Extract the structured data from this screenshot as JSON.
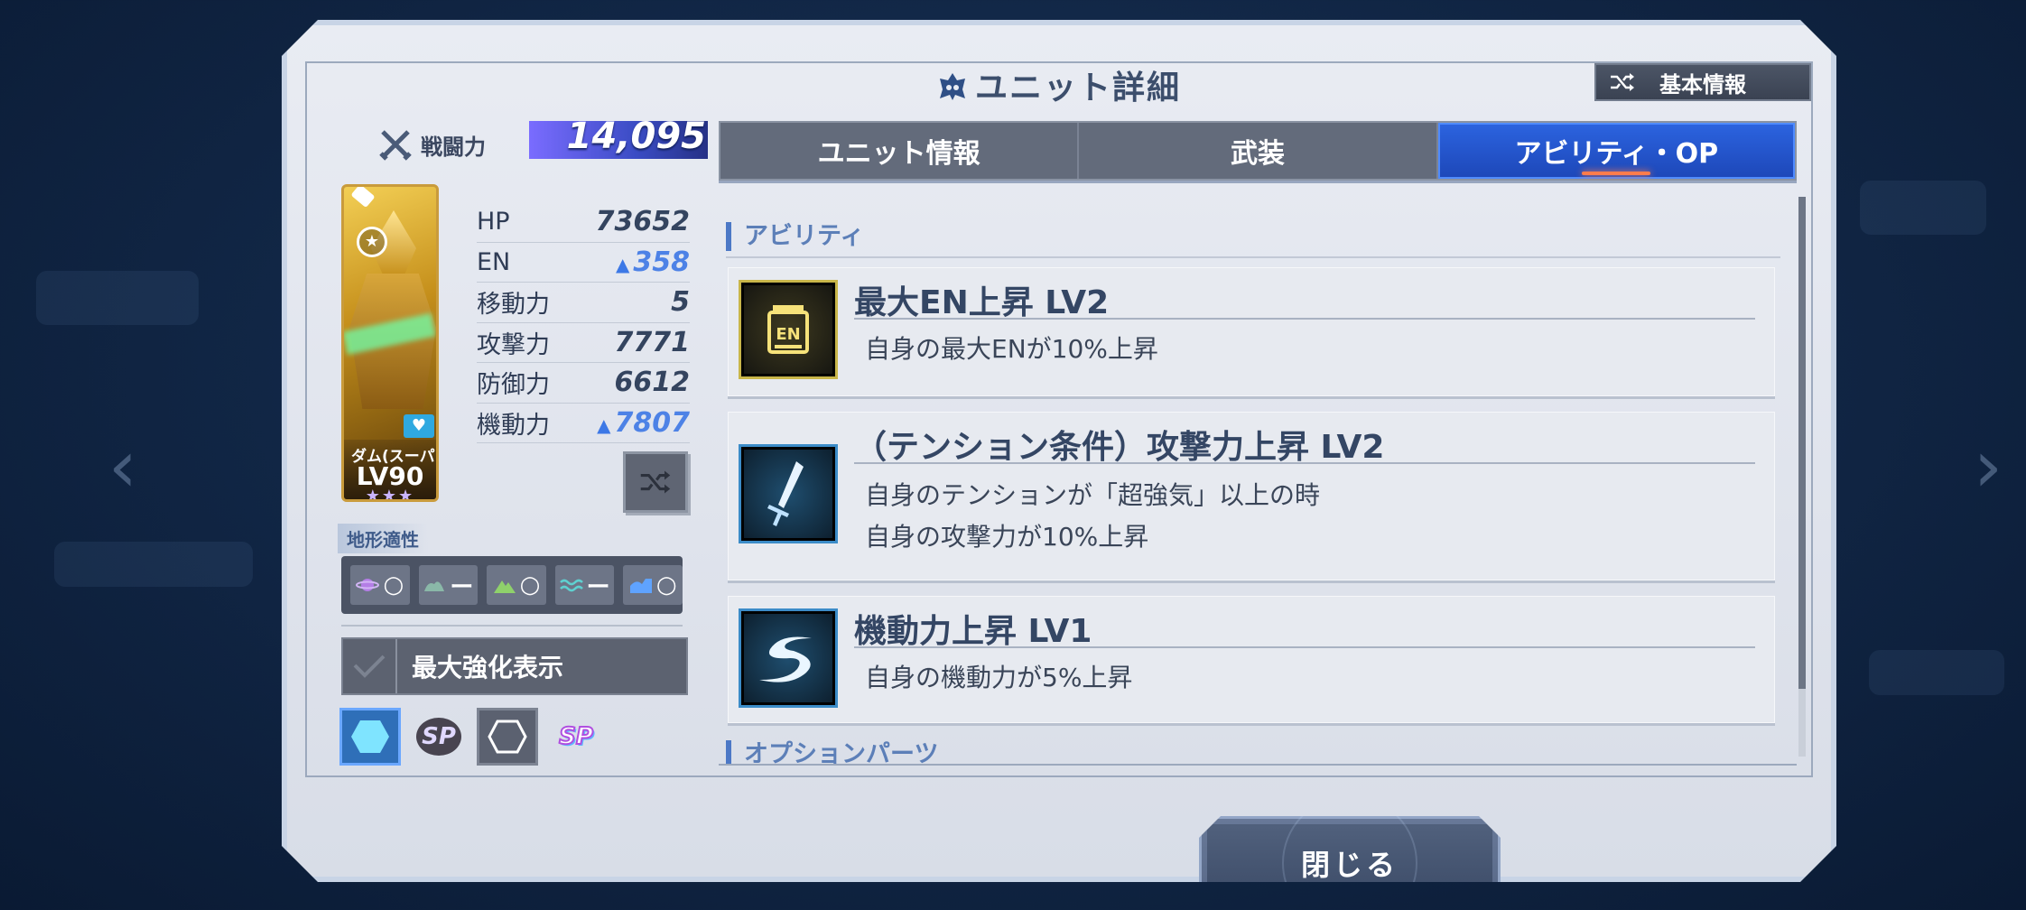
{
  "header": {
    "title": "ユニット詳細",
    "basic_info_button": "基本情報"
  },
  "unit": {
    "power_label": "戦闘力",
    "power_value": "14,095",
    "name": "ダム(スーパー",
    "level": "LV90",
    "stars": "★★★"
  },
  "stats": [
    {
      "label": "HP",
      "value": "73652",
      "boosted": false
    },
    {
      "label": "EN",
      "value": "358",
      "boosted": true
    },
    {
      "label": "移動力",
      "value": "5",
      "boosted": false
    },
    {
      "label": "攻撃力",
      "value": "7771",
      "boosted": false
    },
    {
      "label": "防御力",
      "value": "6612",
      "boosted": false
    },
    {
      "label": "機動力",
      "value": "7807",
      "boosted": true
    }
  ],
  "terrain": {
    "label": "地形適性",
    "items": [
      {
        "icon": "space-icon",
        "grade": "○"
      },
      {
        "icon": "air-icon",
        "grade": "ー"
      },
      {
        "icon": "land-icon",
        "grade": "○"
      },
      {
        "icon": "water-icon",
        "grade": "ー"
      },
      {
        "icon": "underwater-icon",
        "grade": "○"
      }
    ]
  },
  "max_enhance_label": "最大強化表示",
  "sp_label": "SP",
  "tabs": [
    {
      "label": "ユニット情報",
      "active": false
    },
    {
      "label": "武装",
      "active": false
    },
    {
      "label": "アビリティ・OP",
      "active": true
    }
  ],
  "sections": {
    "ability": "アビリティ",
    "option_parts": "オプションパーツ"
  },
  "abilities": [
    {
      "title": "最大EN上昇 LV2",
      "icon": "en-battery-icon",
      "lines": [
        "自身の最大ENが10%上昇"
      ]
    },
    {
      "title": "（テンション条件）攻撃力上昇 LV2",
      "icon": "sword-icon",
      "lines": [
        "自身のテンションが「超強気」以上の時",
        "自身の攻撃力が10%上昇"
      ]
    },
    {
      "title": "機動力上昇 LV1",
      "icon": "mobility-icon",
      "lines": [
        "自身の機動力が5%上昇"
      ]
    }
  ],
  "close_button": "閉じる",
  "colors": {
    "accent_blue": "#1d47b8",
    "boost_blue": "#4d82e6",
    "panel": "#e7eaf0"
  }
}
